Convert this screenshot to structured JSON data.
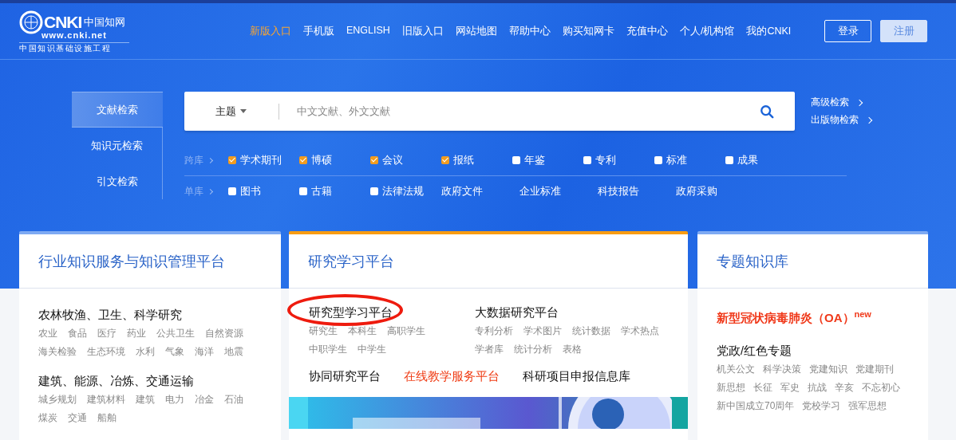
{
  "logo": {
    "mark": "CNKI",
    "name": "中国知网",
    "url": "www.cnki.net",
    "slogan": "中国知识基础设施工程"
  },
  "nav": [
    {
      "label": "新版入口",
      "selected": true
    },
    {
      "label": "手机版",
      "selected": false
    },
    {
      "label": "ENGLISH",
      "selected": false
    },
    {
      "label": "旧版入口",
      "selected": false
    },
    {
      "label": "网站地图",
      "selected": false
    },
    {
      "label": "帮助中心",
      "selected": false
    },
    {
      "label": "购买知网卡",
      "selected": false
    },
    {
      "label": "充值中心",
      "selected": false
    },
    {
      "label": "个人/机构馆",
      "selected": false
    },
    {
      "label": "我的CNKI",
      "selected": false
    }
  ],
  "account_buttons": [
    {
      "label": "登录",
      "kind": "outline"
    },
    {
      "label": "注册",
      "kind": "filled"
    }
  ],
  "search_tabs": [
    {
      "label": "文献检索",
      "selected": true
    },
    {
      "label": "知识元检索",
      "selected": false
    },
    {
      "label": "引文检索",
      "selected": false
    }
  ],
  "search": {
    "field": "主题",
    "placeholder": "中文文献、外文文献"
  },
  "side_links": [
    "高级检索",
    "出版物检索"
  ],
  "source_rows": [
    {
      "label": "跨库",
      "options": [
        {
          "kind": "checkbox",
          "label": "学术期刊",
          "checked": true
        },
        {
          "kind": "checkbox",
          "label": "博硕",
          "checked": true
        },
        {
          "kind": "checkbox",
          "label": "会议",
          "checked": true
        },
        {
          "kind": "checkbox",
          "label": "报纸",
          "checked": true
        },
        {
          "kind": "checkbox",
          "label": "年鉴",
          "checked": false
        },
        {
          "kind": "checkbox",
          "label": "专利",
          "checked": false
        },
        {
          "kind": "checkbox",
          "label": "标准",
          "checked": false
        },
        {
          "kind": "checkbox",
          "label": "成果",
          "checked": false
        }
      ]
    },
    {
      "label": "单库",
      "options": [
        {
          "kind": "checkbox",
          "label": "图书",
          "checked": false
        },
        {
          "kind": "checkbox",
          "label": "古籍",
          "checked": false
        },
        {
          "kind": "checkbox",
          "label": "法律法规",
          "checked": false
        },
        {
          "kind": "link",
          "label": "政府文件"
        },
        {
          "kind": "link",
          "label": "企业标准"
        },
        {
          "kind": "link",
          "label": "科技报告"
        },
        {
          "kind": "link",
          "label": "政府采购"
        }
      ]
    }
  ],
  "cards": [
    {
      "title": "行业知识服务与知识管理平台",
      "selected": false,
      "blocks": [
        {
          "kind": "group",
          "heading": "农林牧渔、卫生、科学研究",
          "items": [
            "农业",
            "食品",
            "医疗",
            "药业",
            "公共卫生",
            "自然资源",
            "海关检验",
            "生态环境",
            "水利",
            "气象",
            "海洋",
            "地震"
          ]
        },
        {
          "kind": "group",
          "heading": "建筑、能源、冶炼、交通运输",
          "items": [
            "城乡规划",
            "建筑材料",
            "建筑",
            "电力",
            "冶金",
            "石油",
            "煤炭",
            "交通",
            "船舶"
          ]
        }
      ]
    },
    {
      "title": "研究学习平台",
      "selected": true,
      "blocks": [
        {
          "kind": "columns",
          "groups": [
            {
              "heading": "研究型学习平台",
              "circled": true,
              "items": [
                "研究生",
                "本科生",
                "高职学生",
                "中职学生",
                "中学生"
              ]
            },
            {
              "heading": "大数据研究平台",
              "circled": false,
              "items": [
                "专利分析",
                "学术图片",
                "统计数据",
                "学术热点",
                "学者库",
                "统计分析",
                "表格"
              ]
            }
          ]
        },
        {
          "kind": "links",
          "links": [
            {
              "label": "协同研究平台",
              "highlight": false
            },
            {
              "label": "在线教学服务平台",
              "highlight": true
            },
            {
              "label": "科研项目申报信息库",
              "highlight": false
            }
          ]
        },
        {
          "kind": "picture"
        }
      ]
    },
    {
      "title": "专题知识库",
      "selected": false,
      "blocks": [
        {
          "kind": "feature",
          "text": "新型冠状病毒肺炎（OA）$^{new}$"
        },
        {
          "kind": "group",
          "heading": "党政/红色专题",
          "items": [
            "机关公文",
            "科学决策",
            "党建知识",
            "党建期刊",
            "新思想",
            "长征",
            "军史",
            "抗战",
            "辛亥",
            "不忘初心",
            "新中国成立70周年",
            "党校学习",
            "强军思想"
          ]
        }
      ]
    }
  ]
}
